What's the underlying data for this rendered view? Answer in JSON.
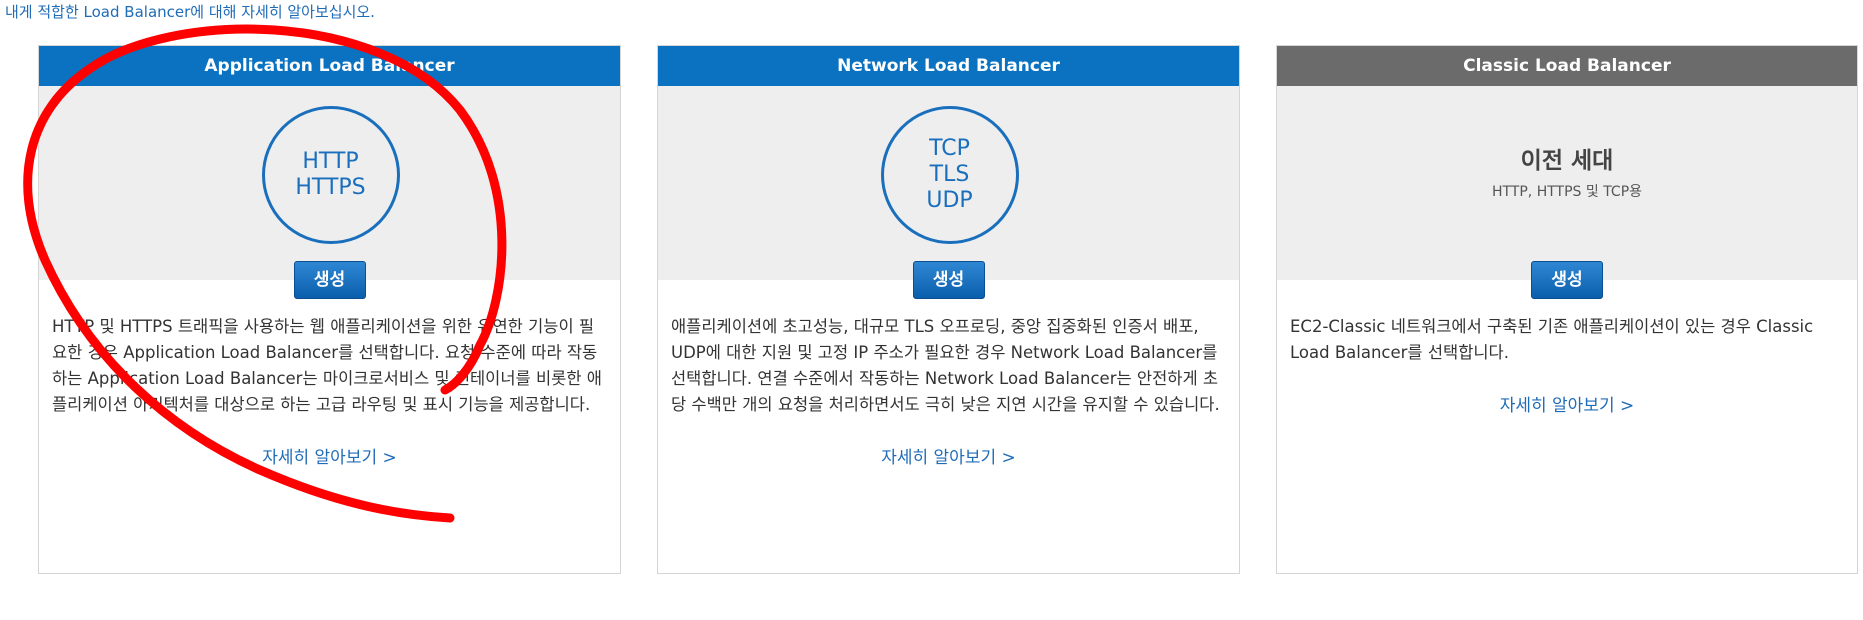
{
  "intro_text": "내게 적합한 Load Balancer에 대해 자세히 알아보십시오.",
  "cards": [
    {
      "title": "Application Load Balancer",
      "protocols": [
        "HTTP",
        "HTTPS"
      ],
      "create_label": "생성",
      "description": "HTTP 및 HTTPS 트래픽을 사용하는 웹 애플리케이션을 위한 유연한 기능이 필요한 경우 Application Load Balancer를 선택합니다. 요청 수준에 따라 작동하는 Application Load Balancer는 마이크로서비스 및 컨테이너를 비롯한 애플리케이션 아키텍처를 대상으로 하는 고급 라우팅 및 표시 기능을 제공합니다.",
      "learn_more": "자세히 알아보기 >"
    },
    {
      "title": "Network Load Balancer",
      "protocols": [
        "TCP",
        "TLS",
        "UDP"
      ],
      "create_label": "생성",
      "description": "애플리케이션에 초고성능, 대규모 TLS 오프로딩, 중앙 집중화된 인증서 배포, UDP에 대한 지원 및 고정 IP 주소가 필요한 경우 Network Load Balancer를 선택합니다. 연결 수준에서 작동하는 Network Load Balancer는 안전하게 초당 수백만 개의 요청을 처리하면서도 극히 낮은 지연 시간을 유지할 수 있습니다.",
      "learn_more": "자세히 알아보기 >"
    },
    {
      "title": "Classic Load Balancer",
      "legacy_title": "이전 세대",
      "legacy_subtitle": "HTTP, HTTPS 및 TCP용",
      "create_label": "생성",
      "description": "EC2-Classic 네트워크에서 구축된 기존 애플리케이션이 있는 경우 Classic Load Balancer를 선택합니다.",
      "learn_more": "자세히 알아보기 >"
    }
  ],
  "colors": {
    "header_blue": "#0a72c1",
    "header_gray": "#6b6b6b",
    "link_blue": "#1f6cb8",
    "annotation_red": "#ff0000"
  }
}
